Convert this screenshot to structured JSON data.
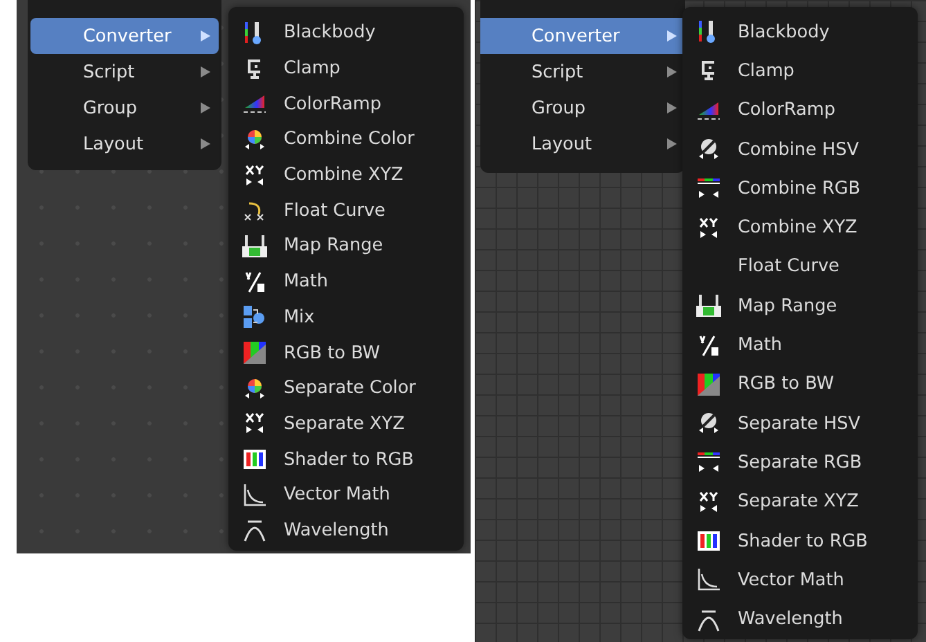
{
  "panels": [
    {
      "kind": "dots",
      "menu": [
        {
          "label": "Converter",
          "selected": true
        },
        {
          "label": "Script",
          "selected": false
        },
        {
          "label": "Group",
          "selected": false
        },
        {
          "label": "Layout",
          "selected": false
        }
      ],
      "submenu": [
        {
          "label": "Blackbody",
          "kind": "thermometer"
        },
        {
          "label": "Clamp",
          "kind": "clamp"
        },
        {
          "label": "ColorRamp",
          "kind": "ramp"
        },
        {
          "label": "Combine Color",
          "kind": "combine-color"
        },
        {
          "label": "Combine XYZ",
          "kind": "combine-xyz"
        },
        {
          "label": "Float Curve",
          "kind": "curve"
        },
        {
          "label": "Map Range",
          "kind": "map-range"
        },
        {
          "label": "Math",
          "kind": "math"
        },
        {
          "label": "Mix",
          "kind": "mix"
        },
        {
          "label": "RGB to BW",
          "kind": "rgb-bw"
        },
        {
          "label": "Separate Color",
          "kind": "separate-color"
        },
        {
          "label": "Separate XYZ",
          "kind": "separate-xyz"
        },
        {
          "label": "Shader to RGB",
          "kind": "bars"
        },
        {
          "label": "Vector Math",
          "kind": "vector-math"
        },
        {
          "label": "Wavelength",
          "kind": "wavelength"
        }
      ]
    },
    {
      "kind": "grid",
      "menu": [
        {
          "label": "Converter",
          "selected": true
        },
        {
          "label": "Script",
          "selected": false
        },
        {
          "label": "Group",
          "selected": false
        },
        {
          "label": "Layout",
          "selected": false
        }
      ],
      "submenu": [
        {
          "label": "Blackbody",
          "kind": "thermometer"
        },
        {
          "label": "Clamp",
          "kind": "clamp"
        },
        {
          "label": "ColorRamp",
          "kind": "ramp"
        },
        {
          "label": "Combine HSV",
          "kind": "combine-hsv"
        },
        {
          "label": "Combine RGB",
          "kind": "combine-rgb"
        },
        {
          "label": "Combine XYZ",
          "kind": "combine-xyz"
        },
        {
          "label": "Float Curve",
          "kind": "plain"
        },
        {
          "label": "Map Range",
          "kind": "map-range"
        },
        {
          "label": "Math",
          "kind": "math"
        },
        {
          "label": "RGB to BW",
          "kind": "rgb-bw"
        },
        {
          "label": "Separate HSV",
          "kind": "separate-hsv"
        },
        {
          "label": "Separate RGB",
          "kind": "separate-rgb"
        },
        {
          "label": "Separate XYZ",
          "kind": "separate-xyz"
        },
        {
          "label": "Shader to RGB",
          "kind": "bars"
        },
        {
          "label": "Vector Math",
          "kind": "vector-math"
        },
        {
          "label": "Wavelength",
          "kind": "wavelength"
        }
      ]
    }
  ]
}
